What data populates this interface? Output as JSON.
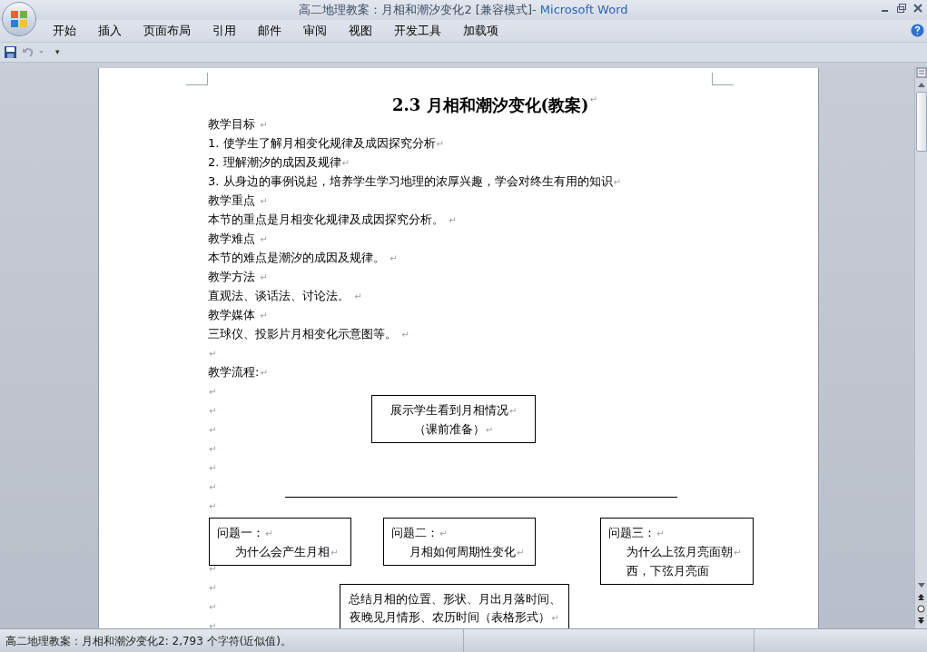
{
  "window": {
    "document_title": "高二地理教案：月相和潮汐变化2 [兼容模式]",
    "app_title": " - Microsoft Word"
  },
  "ribbon_tabs": [
    {
      "label": "开始",
      "selected": false
    },
    {
      "label": "插入",
      "selected": false
    },
    {
      "label": "页面布局",
      "selected": false
    },
    {
      "label": "引用",
      "selected": false
    },
    {
      "label": "邮件",
      "selected": false
    },
    {
      "label": "审阅",
      "selected": false
    },
    {
      "label": "视图",
      "selected": false
    },
    {
      "label": "开发工具",
      "selected": false
    },
    {
      "label": "加载项",
      "selected": false
    }
  ],
  "quick_access": {
    "customize": "▾"
  },
  "document": {
    "title": "2.3 月相和潮汐变化(教案)",
    "title_mark": "↵",
    "paragraphs": [
      {
        "text": "教学目标 ",
        "mark": "↵"
      },
      {
        "text": "1. 使学生了解月相变化规律及成因探究分析",
        "mark": "↵"
      },
      {
        "text": "2. 理解潮汐的成因及规律",
        "mark": "↵"
      },
      {
        "text": "3. 从身边的事例说起，培养学生学习地理的浓厚兴趣，学会对终生有用的知识",
        "mark": "↵"
      },
      {
        "text": "教学重点 ",
        "mark": "↵"
      },
      {
        "text": "本节的重点是月相变化规律及成因探究分析。 ",
        "mark": "↵"
      },
      {
        "text": "教学难点 ",
        "mark": "↵"
      },
      {
        "text": "本节的难点是潮汐的成因及规律。 ",
        "mark": "↵"
      },
      {
        "text": "教学方法 ",
        "mark": "↵"
      },
      {
        "text": "直观法、谈话法、讨论法。 ",
        "mark": "↵"
      },
      {
        "text": "教学媒体 ",
        "mark": "↵"
      },
      {
        "text": "三球仪、投影片月相变化示意图等。 ",
        "mark": "↵"
      },
      {
        "mark": "↵"
      },
      {
        "text": "教学流程:",
        "mark": "↵"
      },
      {
        "mark": "↵"
      },
      {
        "mark": "↵"
      },
      {
        "mark": "↵"
      },
      {
        "mark": "↵"
      },
      {
        "mark": "↵"
      },
      {
        "mark": "↵"
      },
      {
        "mark": "↵"
      }
    ],
    "paragraphs_below_boxes": [
      {
        "mark": "↵"
      },
      {
        "mark": "↵"
      },
      {
        "mark": "↵"
      },
      {
        "mark": "↵"
      }
    ],
    "flow_boxes": [
      {
        "kind": "top",
        "lines": [
          {
            "text": "展示学生看到月相情况",
            "mark": "↵"
          },
          {
            "text": "（课前准备）",
            "mark": "↵"
          }
        ]
      },
      {
        "kind": "q1",
        "lines": [
          {
            "text": "问题一：",
            "mark": "↵"
          },
          {
            "text": "为什么会产生月相",
            "mark": "↵"
          }
        ]
      },
      {
        "kind": "q2",
        "lines": [
          {
            "text": "问题二：",
            "mark": "↵"
          },
          {
            "text": "月相如何周期性变化",
            "mark": "↵"
          }
        ]
      },
      {
        "kind": "q3",
        "lines": [
          {
            "text": "问题三：",
            "mark": "↵"
          },
          {
            "text": "为什么上弦月亮面朝",
            "mark": "↵"
          },
          {
            "text": "西，下弦月亮面"
          }
        ]
      },
      {
        "kind": "summary",
        "lines": [
          {
            "text": "总结月相的位置、形状、月出月落时间、"
          },
          {
            "text": "夜晚见月情形、农历时间（表格形式）",
            "mark": "↵"
          }
        ]
      }
    ]
  },
  "status_bar": {
    "text": "高二地理教案：月相和潮汐变化2: 2,793 个字符(近似值)。"
  }
}
